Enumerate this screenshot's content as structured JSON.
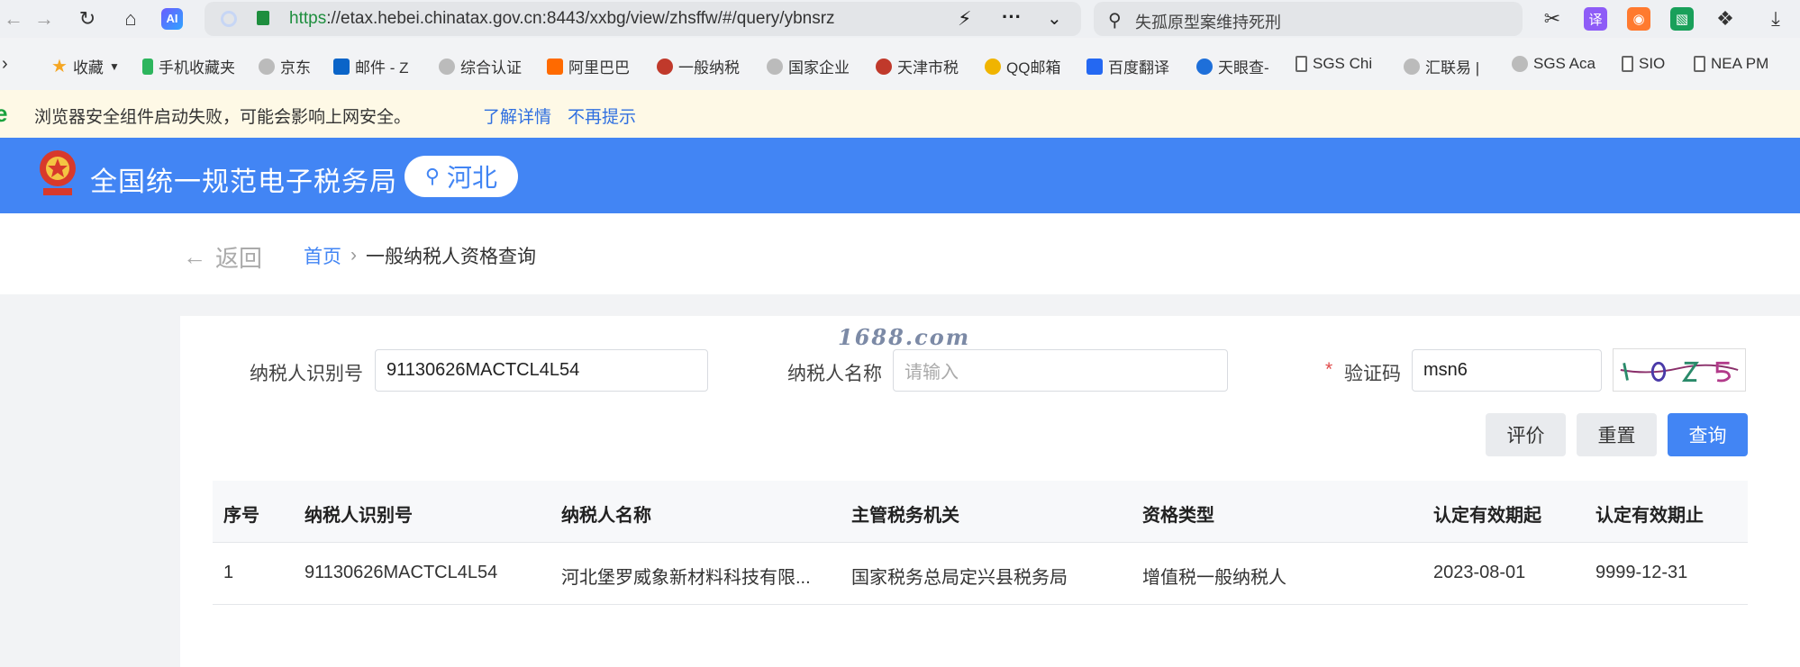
{
  "browser": {
    "url_scheme": "https",
    "url_rest": "://etax.hebei.chinatax.gov.cn:8443/xxbg/view/zhsffw/#/query/ybnsrz",
    "search_placeholder": "失孤原型案维持死刑",
    "ai_label": "AI",
    "translate_label": "译"
  },
  "bookmarks": [
    {
      "label": "收藏",
      "icon": "star-icon",
      "color": "#f5a623"
    },
    {
      "label": "手机收藏夹",
      "icon": "phone-icon",
      "color": "#2db55d"
    },
    {
      "label": "京东",
      "icon": "globe-icon",
      "color": "#999999"
    },
    {
      "label": "邮件 - Z",
      "icon": "outlook-icon",
      "color": "#0a64c8"
    },
    {
      "label": "综合认证",
      "icon": "globe-icon",
      "color": "#999999"
    },
    {
      "label": "阿里巴巴",
      "icon": "alibaba-icon",
      "color": "#ff6a00"
    },
    {
      "label": "一般纳税",
      "icon": "emblem-icon",
      "color": "#c0392b"
    },
    {
      "label": "国家企业",
      "icon": "globe-icon",
      "color": "#999999"
    },
    {
      "label": "天津市税",
      "icon": "emblem-icon",
      "color": "#c0392b"
    },
    {
      "label": "QQ邮箱",
      "icon": "qq-icon",
      "color": "#f0b400"
    },
    {
      "label": "百度翻译",
      "icon": "translate-icon",
      "color": "#2468f2"
    },
    {
      "label": "天眼查-",
      "icon": "tianyancha-icon",
      "color": "#1e6fd9"
    },
    {
      "label": "SGS Chi",
      "icon": "page-icon",
      "color": "#666666"
    },
    {
      "label": "汇联易 |",
      "icon": "globe-icon",
      "color": "#999999"
    },
    {
      "label": "SGS Aca",
      "icon": "globe-icon",
      "color": "#999999"
    },
    {
      "label": "SIO",
      "icon": "page-icon",
      "color": "#666666"
    },
    {
      "label": "NEA PM",
      "icon": "page-icon",
      "color": "#666666"
    }
  ],
  "infobar": {
    "message": "浏览器安全组件启动失败，可能会影响上网安全。",
    "learn_more": "了解详情",
    "dont_show": "不再提示"
  },
  "header": {
    "title": "全国统一规范电子税务局",
    "region": "河北",
    "color": "#4285f4"
  },
  "breadcrumb": {
    "back": "返回",
    "home": "首页",
    "current": "一般纳税人资格查询"
  },
  "watermark": "1688.com",
  "form": {
    "taxpayer_id_label": "纳税人识别号",
    "taxpayer_id_value": "91130626MACTCL4L54",
    "taxpayer_name_label": "纳税人名称",
    "taxpayer_name_placeholder": "请输入",
    "required_mark": "*",
    "captcha_label": "验证码",
    "captcha_value": "msn6"
  },
  "buttons": {
    "rate": "评价",
    "reset": "重置",
    "query": "查询"
  },
  "table": {
    "columns": [
      "序号",
      "纳税人识别号",
      "纳税人名称",
      "主管税务机关",
      "资格类型",
      "认定有效期起",
      "认定有效期止"
    ],
    "rows": [
      [
        "1",
        "91130626MACTCL4L54",
        "河北堡罗威象新材料科技有限...",
        "国家税务总局定兴县税务局",
        "增值税一般纳税人",
        "2023-08-01",
        "9999-12-31"
      ]
    ]
  }
}
